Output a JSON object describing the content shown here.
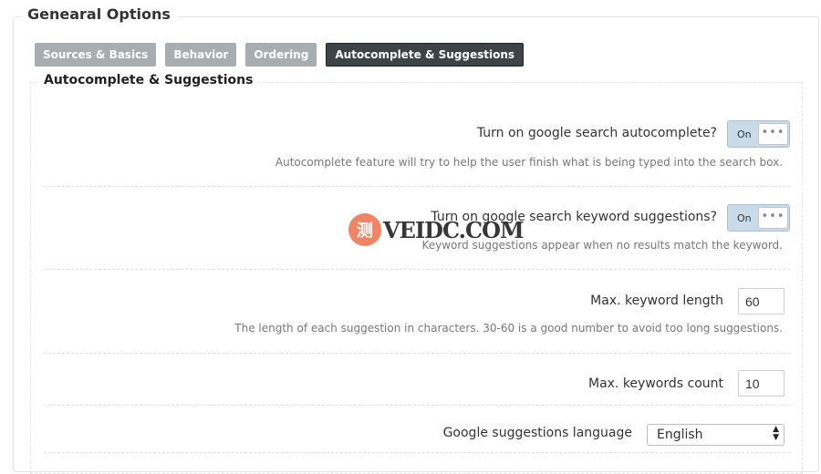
{
  "outer_title": "Genearal Options",
  "tabs": [
    {
      "label": "Sources & Basics"
    },
    {
      "label": "Behavior"
    },
    {
      "label": "Ordering"
    },
    {
      "label": "Autocomplete & Suggestions"
    }
  ],
  "active_tab": "Autocomplete & Suggestions",
  "panel_title": "Autocomplete & Suggestions",
  "options": {
    "autocomplete": {
      "label": "Turn on google search autocomplete?",
      "toggle_text": "On",
      "description": "Autocomplete feature will try to help the user finish what is being typed into the search box."
    },
    "keyword_suggestions": {
      "label": "Turn on google search keyword suggestions?",
      "toggle_text": "On",
      "description": "Keyword suggestions appear when no results match the keyword."
    },
    "max_keyword_length": {
      "label": "Max. keyword length",
      "value": "60",
      "description": "The length of each suggestion in characters. 30-60 is a good number to avoid too long suggestions."
    },
    "max_keywords_count": {
      "label": "Max. keywords count",
      "value": "10"
    },
    "suggestions_language": {
      "label": "Google suggestions language",
      "value": "English"
    }
  },
  "watermark": {
    "logo_text": "测",
    "text": "VEIDC.COM"
  },
  "colors": {
    "tab_inactive": "#a7adb1",
    "tab_active": "#3c4448",
    "toggle_on": "#c9dbe8",
    "watermark_logo": "#f08466"
  },
  "icons": {
    "toggle_knob": "dots-icon",
    "select_arrow": "updown-arrow-icon"
  }
}
